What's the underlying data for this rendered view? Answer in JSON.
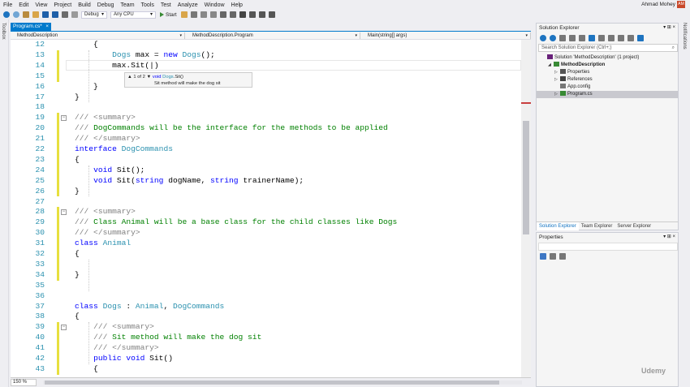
{
  "menu": {
    "items": [
      "File",
      "Edit",
      "View",
      "Project",
      "Build",
      "Debug",
      "Team",
      "Tools",
      "Test",
      "Analyze",
      "Window",
      "Help"
    ],
    "user_name": "Ahmad Mohey",
    "user_initials": "AM"
  },
  "toolbar": {
    "config": "Debug",
    "platform": "Any CPU",
    "start_label": "Start"
  },
  "side_strips": {
    "left": "Toolbox",
    "right": "Notifications"
  },
  "editor": {
    "tab_label": "Program.cs*",
    "tab_close": "×",
    "nav": {
      "project": "MethodDescription",
      "type": "MethodDescription.Program",
      "member": "Main(string[] args)"
    },
    "zoom": "150 %",
    "lines": [
      {
        "n": "12",
        "tokens": [
          {
            "t": "        {",
            "c": ""
          }
        ]
      },
      {
        "n": "13",
        "tokens": [
          {
            "t": "            ",
            "c": ""
          },
          {
            "t": "Dogs",
            "c": "ty"
          },
          {
            "t": " max = ",
            "c": ""
          },
          {
            "t": "new",
            "c": "kw"
          },
          {
            "t": " ",
            "c": ""
          },
          {
            "t": "Dogs",
            "c": "ty"
          },
          {
            "t": "();",
            "c": ""
          }
        ]
      },
      {
        "n": "14",
        "tokens": [
          {
            "t": "            max.Sit(|)",
            "c": ""
          }
        ]
      },
      {
        "n": "15",
        "tokens": [
          {
            "t": "",
            "c": ""
          }
        ]
      },
      {
        "n": "16",
        "tokens": [
          {
            "t": "        }",
            "c": ""
          }
        ]
      },
      {
        "n": "17",
        "tokens": [
          {
            "t": "    }",
            "c": ""
          }
        ]
      },
      {
        "n": "18",
        "tokens": [
          {
            "t": "",
            "c": ""
          }
        ]
      },
      {
        "n": "19",
        "tokens": [
          {
            "t": "    ",
            "c": ""
          },
          {
            "t": "/// <summary>",
            "c": "cmg"
          }
        ]
      },
      {
        "n": "20",
        "tokens": [
          {
            "t": "    ",
            "c": ""
          },
          {
            "t": "/// ",
            "c": "cmg"
          },
          {
            "t": "DogCommands will be the interface for the methods to be applied",
            "c": "cm"
          }
        ]
      },
      {
        "n": "21",
        "tokens": [
          {
            "t": "    ",
            "c": ""
          },
          {
            "t": "/// </summary>",
            "c": "cmg"
          }
        ]
      },
      {
        "n": "22",
        "tokens": [
          {
            "t": "    ",
            "c": ""
          },
          {
            "t": "interface",
            "c": "kw"
          },
          {
            "t": " ",
            "c": ""
          },
          {
            "t": "DogCommands",
            "c": "ty"
          }
        ]
      },
      {
        "n": "23",
        "tokens": [
          {
            "t": "    {",
            "c": ""
          }
        ]
      },
      {
        "n": "24",
        "tokens": [
          {
            "t": "        ",
            "c": ""
          },
          {
            "t": "void",
            "c": "kw"
          },
          {
            "t": " Sit();",
            "c": ""
          }
        ]
      },
      {
        "n": "25",
        "tokens": [
          {
            "t": "        ",
            "c": ""
          },
          {
            "t": "void",
            "c": "kw"
          },
          {
            "t": " Sit(",
            "c": ""
          },
          {
            "t": "string",
            "c": "kw"
          },
          {
            "t": " dogName, ",
            "c": ""
          },
          {
            "t": "string",
            "c": "kw"
          },
          {
            "t": " trainerName);",
            "c": ""
          }
        ]
      },
      {
        "n": "26",
        "tokens": [
          {
            "t": "    }",
            "c": ""
          }
        ]
      },
      {
        "n": "27",
        "tokens": [
          {
            "t": "",
            "c": ""
          }
        ]
      },
      {
        "n": "28",
        "tokens": [
          {
            "t": "    ",
            "c": ""
          },
          {
            "t": "/// <summary>",
            "c": "cmg"
          }
        ]
      },
      {
        "n": "29",
        "tokens": [
          {
            "t": "    ",
            "c": ""
          },
          {
            "t": "/// ",
            "c": "cmg"
          },
          {
            "t": "Class Animal will be a base class for the child classes like Dogs",
            "c": "cm"
          }
        ]
      },
      {
        "n": "30",
        "tokens": [
          {
            "t": "    ",
            "c": ""
          },
          {
            "t": "/// </summary>",
            "c": "cmg"
          }
        ]
      },
      {
        "n": "31",
        "tokens": [
          {
            "t": "    ",
            "c": ""
          },
          {
            "t": "class",
            "c": "kw"
          },
          {
            "t": " ",
            "c": ""
          },
          {
            "t": "Animal",
            "c": "ty"
          }
        ]
      },
      {
        "n": "32",
        "tokens": [
          {
            "t": "    {",
            "c": ""
          }
        ]
      },
      {
        "n": "33",
        "tokens": [
          {
            "t": "",
            "c": ""
          }
        ]
      },
      {
        "n": "34",
        "tokens": [
          {
            "t": "    }",
            "c": ""
          }
        ]
      },
      {
        "n": "35",
        "tokens": [
          {
            "t": "",
            "c": ""
          }
        ]
      },
      {
        "n": "36",
        "tokens": [
          {
            "t": "",
            "c": ""
          }
        ]
      },
      {
        "n": "37",
        "tokens": [
          {
            "t": "    ",
            "c": ""
          },
          {
            "t": "class",
            "c": "kw"
          },
          {
            "t": " ",
            "c": ""
          },
          {
            "t": "Dogs",
            "c": "ty"
          },
          {
            "t": " : ",
            "c": ""
          },
          {
            "t": "Animal",
            "c": "ty"
          },
          {
            "t": ", ",
            "c": ""
          },
          {
            "t": "DogCommands",
            "c": "ty"
          }
        ]
      },
      {
        "n": "38",
        "tokens": [
          {
            "t": "    {",
            "c": ""
          }
        ]
      },
      {
        "n": "39",
        "tokens": [
          {
            "t": "        ",
            "c": ""
          },
          {
            "t": "/// <summary>",
            "c": "cmg"
          }
        ]
      },
      {
        "n": "40",
        "tokens": [
          {
            "t": "        ",
            "c": ""
          },
          {
            "t": "/// ",
            "c": "cmg"
          },
          {
            "t": "Sit method will make the dog sit",
            "c": "cm"
          }
        ]
      },
      {
        "n": "41",
        "tokens": [
          {
            "t": "        ",
            "c": ""
          },
          {
            "t": "/// </summary>",
            "c": "cmg"
          }
        ]
      },
      {
        "n": "42",
        "tokens": [
          {
            "t": "        ",
            "c": ""
          },
          {
            "t": "public",
            "c": "kw"
          },
          {
            "t": " ",
            "c": ""
          },
          {
            "t": "void",
            "c": "kw"
          },
          {
            "t": " Sit()",
            "c": ""
          }
        ]
      },
      {
        "n": "43",
        "tokens": [
          {
            "t": "        {",
            "c": ""
          }
        ]
      }
    ],
    "signature_help": {
      "counter": "1 of 2",
      "up_arrow": "▲",
      "down_arrow": "▼",
      "kw_void": "void",
      "type": "Dogs",
      "member": ".Sit()",
      "description": "Sit method will make the dog sit"
    }
  },
  "solution_explorer": {
    "title": "Solution Explorer",
    "controls": "▾ ⊞ ×",
    "search_placeholder": "Search Solution Explorer (Ctrl+;)",
    "tree": [
      {
        "label": "Solution 'MethodDescription' (1 project)",
        "arrow": "",
        "icon": "solution-icon",
        "bold": false
      },
      {
        "label": "MethodDescription",
        "arrow": "◢",
        "icon": "csharp-project-icon",
        "bold": true
      },
      {
        "label": "Properties",
        "arrow": "▷",
        "icon": "wrench-icon",
        "bold": false
      },
      {
        "label": "References",
        "arrow": "▷",
        "icon": "references-icon",
        "bold": false
      },
      {
        "label": "App.config",
        "arrow": "",
        "icon": "config-file-icon",
        "bold": false
      },
      {
        "label": "Program.cs",
        "arrow": "▷",
        "icon": "csharp-file-icon",
        "bold": false,
        "selected": true
      }
    ],
    "tabs": [
      "Solution Explorer",
      "Team Explorer",
      "Server Explorer"
    ]
  },
  "properties": {
    "title": "Properties",
    "controls": "▾ ⊞ ×"
  },
  "watermark": "Udemy",
  "colors": {
    "accent": "#007acc",
    "keyword": "#0000ff",
    "type": "#2b91af",
    "comment": "#008000",
    "change_marker": "#e7df3e"
  }
}
